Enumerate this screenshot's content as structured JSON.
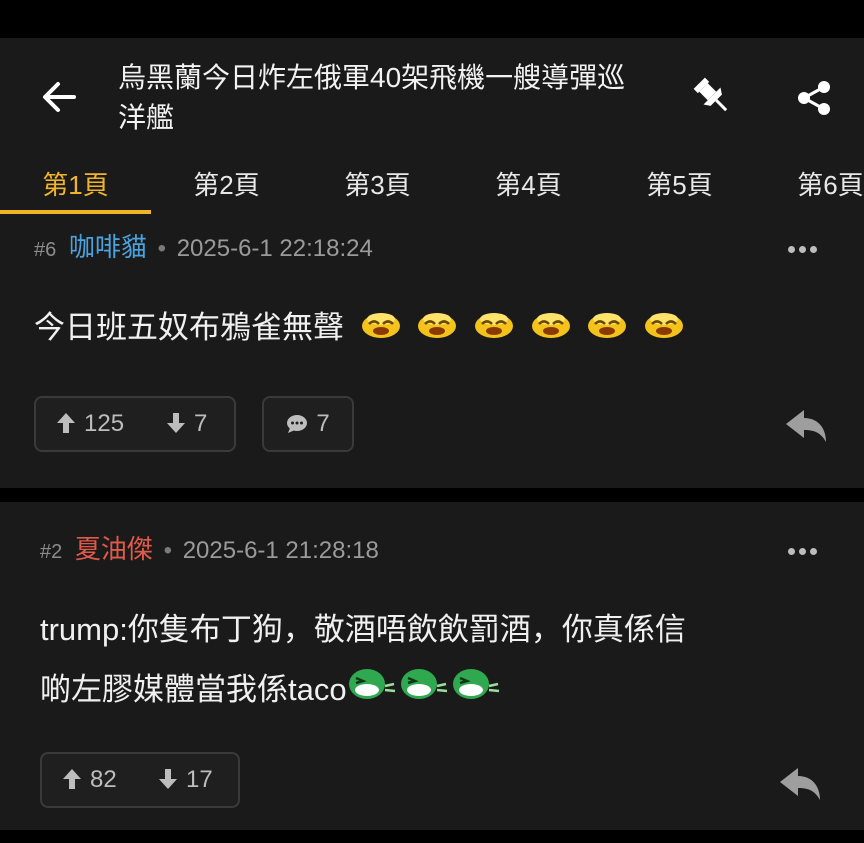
{
  "header": {
    "title": "烏黑蘭今日炸左俄軍40架飛機一艘導彈巡洋艦",
    "back_icon": "arrow-left-icon",
    "pin_icon": "pushpin-icon",
    "share_icon": "share-icon"
  },
  "tabs": [
    {
      "label": "第1頁",
      "active": true
    },
    {
      "label": "第2頁"
    },
    {
      "label": "第3頁"
    },
    {
      "label": "第4頁"
    },
    {
      "label": "第5頁"
    },
    {
      "label": "第6頁"
    }
  ],
  "posts": [
    {
      "num": "#6",
      "author": "咖啡貓",
      "author_color": "#4aa3df",
      "time": "2025-6-1 22:18:24",
      "body": "今日班五奴布鴉雀無聲",
      "emoji_count": 6,
      "upvotes": "125",
      "downvotes": "7",
      "comments": "7"
    },
    {
      "num": "#2",
      "author": "夏油傑",
      "author_color": "#e05a4a",
      "time": "2025-6-1 21:28:18",
      "body_line1": "trump:你隻布丁狗，敬酒唔飲飲罰酒，你真係信",
      "body_line2": "啲左膠媒體當我係taco",
      "emoji_count": 3,
      "upvotes": "82",
      "downvotes": "17"
    }
  ],
  "colors": {
    "accent": "#f0b429",
    "background": "#1a1a1a"
  }
}
